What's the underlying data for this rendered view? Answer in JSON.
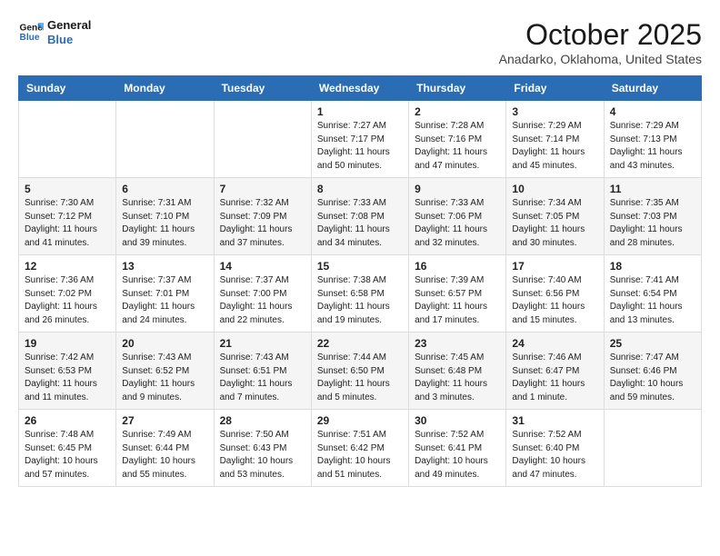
{
  "header": {
    "logo_line1": "General",
    "logo_line2": "Blue",
    "month": "October 2025",
    "location": "Anadarko, Oklahoma, United States"
  },
  "days_of_week": [
    "Sunday",
    "Monday",
    "Tuesday",
    "Wednesday",
    "Thursday",
    "Friday",
    "Saturday"
  ],
  "weeks": [
    [
      {
        "day": "",
        "detail": ""
      },
      {
        "day": "",
        "detail": ""
      },
      {
        "day": "",
        "detail": ""
      },
      {
        "day": "1",
        "detail": "Sunrise: 7:27 AM\nSunset: 7:17 PM\nDaylight: 11 hours\nand 50 minutes."
      },
      {
        "day": "2",
        "detail": "Sunrise: 7:28 AM\nSunset: 7:16 PM\nDaylight: 11 hours\nand 47 minutes."
      },
      {
        "day": "3",
        "detail": "Sunrise: 7:29 AM\nSunset: 7:14 PM\nDaylight: 11 hours\nand 45 minutes."
      },
      {
        "day": "4",
        "detail": "Sunrise: 7:29 AM\nSunset: 7:13 PM\nDaylight: 11 hours\nand 43 minutes."
      }
    ],
    [
      {
        "day": "5",
        "detail": "Sunrise: 7:30 AM\nSunset: 7:12 PM\nDaylight: 11 hours\nand 41 minutes."
      },
      {
        "day": "6",
        "detail": "Sunrise: 7:31 AM\nSunset: 7:10 PM\nDaylight: 11 hours\nand 39 minutes."
      },
      {
        "day": "7",
        "detail": "Sunrise: 7:32 AM\nSunset: 7:09 PM\nDaylight: 11 hours\nand 37 minutes."
      },
      {
        "day": "8",
        "detail": "Sunrise: 7:33 AM\nSunset: 7:08 PM\nDaylight: 11 hours\nand 34 minutes."
      },
      {
        "day": "9",
        "detail": "Sunrise: 7:33 AM\nSunset: 7:06 PM\nDaylight: 11 hours\nand 32 minutes."
      },
      {
        "day": "10",
        "detail": "Sunrise: 7:34 AM\nSunset: 7:05 PM\nDaylight: 11 hours\nand 30 minutes."
      },
      {
        "day": "11",
        "detail": "Sunrise: 7:35 AM\nSunset: 7:03 PM\nDaylight: 11 hours\nand 28 minutes."
      }
    ],
    [
      {
        "day": "12",
        "detail": "Sunrise: 7:36 AM\nSunset: 7:02 PM\nDaylight: 11 hours\nand 26 minutes."
      },
      {
        "day": "13",
        "detail": "Sunrise: 7:37 AM\nSunset: 7:01 PM\nDaylight: 11 hours\nand 24 minutes."
      },
      {
        "day": "14",
        "detail": "Sunrise: 7:37 AM\nSunset: 7:00 PM\nDaylight: 11 hours\nand 22 minutes."
      },
      {
        "day": "15",
        "detail": "Sunrise: 7:38 AM\nSunset: 6:58 PM\nDaylight: 11 hours\nand 19 minutes."
      },
      {
        "day": "16",
        "detail": "Sunrise: 7:39 AM\nSunset: 6:57 PM\nDaylight: 11 hours\nand 17 minutes."
      },
      {
        "day": "17",
        "detail": "Sunrise: 7:40 AM\nSunset: 6:56 PM\nDaylight: 11 hours\nand 15 minutes."
      },
      {
        "day": "18",
        "detail": "Sunrise: 7:41 AM\nSunset: 6:54 PM\nDaylight: 11 hours\nand 13 minutes."
      }
    ],
    [
      {
        "day": "19",
        "detail": "Sunrise: 7:42 AM\nSunset: 6:53 PM\nDaylight: 11 hours\nand 11 minutes."
      },
      {
        "day": "20",
        "detail": "Sunrise: 7:43 AM\nSunset: 6:52 PM\nDaylight: 11 hours\nand 9 minutes."
      },
      {
        "day": "21",
        "detail": "Sunrise: 7:43 AM\nSunset: 6:51 PM\nDaylight: 11 hours\nand 7 minutes."
      },
      {
        "day": "22",
        "detail": "Sunrise: 7:44 AM\nSunset: 6:50 PM\nDaylight: 11 hours\nand 5 minutes."
      },
      {
        "day": "23",
        "detail": "Sunrise: 7:45 AM\nSunset: 6:48 PM\nDaylight: 11 hours\nand 3 minutes."
      },
      {
        "day": "24",
        "detail": "Sunrise: 7:46 AM\nSunset: 6:47 PM\nDaylight: 11 hours\nand 1 minute."
      },
      {
        "day": "25",
        "detail": "Sunrise: 7:47 AM\nSunset: 6:46 PM\nDaylight: 10 hours\nand 59 minutes."
      }
    ],
    [
      {
        "day": "26",
        "detail": "Sunrise: 7:48 AM\nSunset: 6:45 PM\nDaylight: 10 hours\nand 57 minutes."
      },
      {
        "day": "27",
        "detail": "Sunrise: 7:49 AM\nSunset: 6:44 PM\nDaylight: 10 hours\nand 55 minutes."
      },
      {
        "day": "28",
        "detail": "Sunrise: 7:50 AM\nSunset: 6:43 PM\nDaylight: 10 hours\nand 53 minutes."
      },
      {
        "day": "29",
        "detail": "Sunrise: 7:51 AM\nSunset: 6:42 PM\nDaylight: 10 hours\nand 51 minutes."
      },
      {
        "day": "30",
        "detail": "Sunrise: 7:52 AM\nSunset: 6:41 PM\nDaylight: 10 hours\nand 49 minutes."
      },
      {
        "day": "31",
        "detail": "Sunrise: 7:52 AM\nSunset: 6:40 PM\nDaylight: 10 hours\nand 47 minutes."
      },
      {
        "day": "",
        "detail": ""
      }
    ]
  ]
}
